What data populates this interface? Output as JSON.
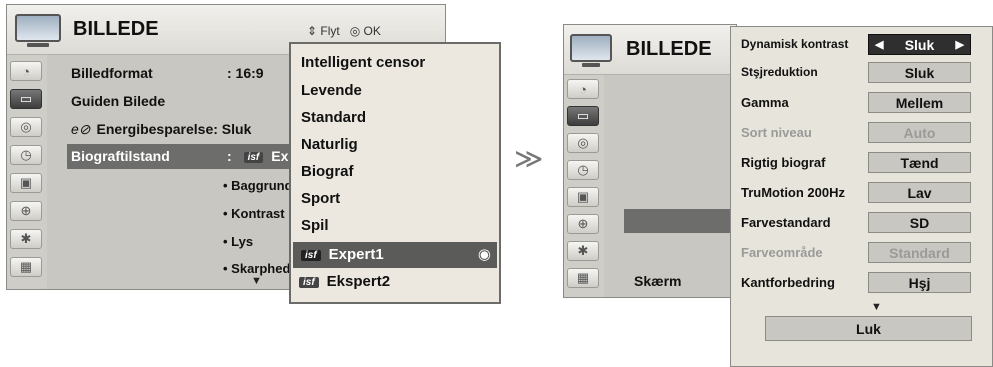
{
  "left_menu": {
    "title": "BILLEDE",
    "hint": "⇕ Flyt   ◎ OK",
    "rows": {
      "billedformat": "Billedformat",
      "billedformat_value": ": 16:9",
      "guiden": "Guiden Bilede",
      "energi_prefix": "e⊘",
      "energi": "Energibesparelse: Sluk",
      "biograf": "Biograftilstand",
      "biograf_value_prefix": ":",
      "biograf_value": "Exp"
    },
    "sub_items": [
      "• Baggrunds",
      "• Kontrast",
      "• Lys",
      "• Skarphed"
    ],
    "more_arrow": "▼"
  },
  "popup": {
    "items": [
      "Intelligent censor",
      "Levende",
      "Standard",
      "Naturlig",
      "Biograf",
      "Sport",
      "Spil",
      "Expert1",
      "Ekspert2"
    ],
    "badge": "isf",
    "selected_marker": "◉"
  },
  "transition_arrow": "≫",
  "right_menu": {
    "title": "BILLEDE",
    "bottom_label": "Skærm",
    "settings": [
      {
        "label": "Dynamisk kontrast",
        "value": "Sluk"
      },
      {
        "label": "Stşjreduktion",
        "value": "Sluk"
      },
      {
        "label": "Gamma",
        "value": "Mellem"
      },
      {
        "label": "Sort niveau",
        "value": "Auto"
      },
      {
        "label": "Rigtig biograf",
        "value": "Tænd"
      },
      {
        "label": "TruMotion 200Hz",
        "value": "Lav"
      },
      {
        "label": "Farvestandard",
        "value": "SD"
      },
      {
        "label": "Farveområde",
        "value": "Standard"
      },
      {
        "label": "Kantforbedring",
        "value": "Hşj"
      }
    ],
    "selector_left": "◀",
    "selector_right": "▶",
    "more_arrow": "▼",
    "close_label": "Luk"
  },
  "icons": [
    "satellite-icon",
    "tv-icon",
    "speaker-icon",
    "clock-icon",
    "lock-icon",
    "usb-icon",
    "bluetooth-icon",
    "movie-icon"
  ]
}
